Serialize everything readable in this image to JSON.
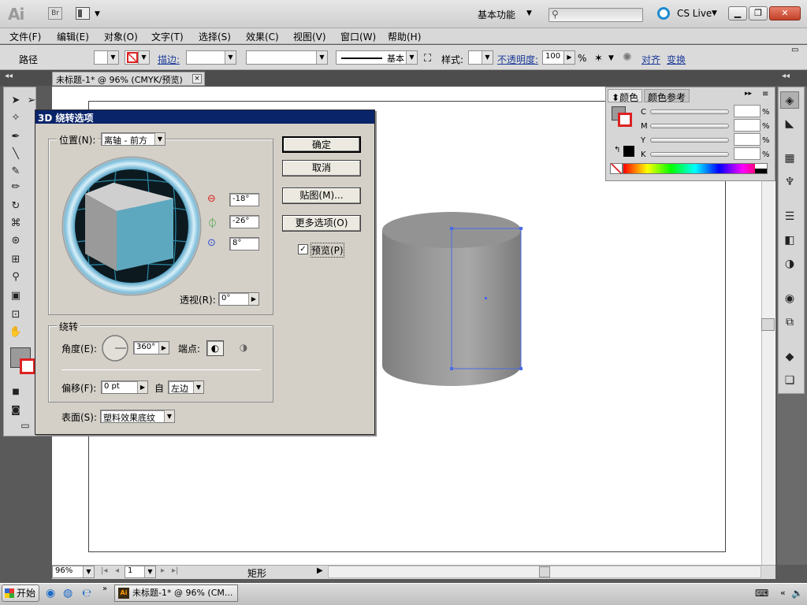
{
  "appbar": {
    "logo": "Ai",
    "bridge": "Br",
    "workspace": "基本功能",
    "cslive": "CS Live"
  },
  "menus": [
    "文件(F)",
    "编辑(E)",
    "对象(O)",
    "文字(T)",
    "选择(S)",
    "效果(C)",
    "视图(V)",
    "窗口(W)",
    "帮助(H)"
  ],
  "control": {
    "object_type": "路径",
    "stroke_label": "描边:",
    "stroke_profile": "基本",
    "style_label": "样式:",
    "opacity_label": "不透明度:",
    "opacity_value": "100",
    "opacity_unit": "%",
    "align_label": "对齐",
    "transform_label": "变换"
  },
  "document_tab": {
    "title": "未标题-1* @ 96% (CMYK/预览)",
    "close": "×"
  },
  "dialog": {
    "title": "3D 绕转选项",
    "position_label": "位置(N):",
    "position_value": "离轴 - 前方",
    "x_rotation": "-18°",
    "y_rotation": "-26°",
    "z_rotation": "8°",
    "perspective_label": "透视(R):",
    "perspective_value": "0°",
    "revolve_group": "绕转",
    "angle_label": "角度(E):",
    "angle_value": "360°",
    "cap_label": "端点:",
    "offset_label": "偏移(F):",
    "offset_value": "0 pt",
    "from_label": "自",
    "from_value": "左边",
    "surface_label": "表面(S):",
    "surface_value": "塑料效果底纹",
    "ok_button": "确定",
    "cancel_button": "取消",
    "map_art_button": "贴图(M)...",
    "more_options_button": "更多选项(O)",
    "preview_label": "预览(P)",
    "preview_checked": "✓"
  },
  "color_panel": {
    "tab_color": "颜色",
    "tab_guide": "颜色参考",
    "rows": [
      "C",
      "M",
      "Y",
      "K"
    ],
    "pct": "%"
  },
  "status": {
    "zoom": "96%",
    "page": "1",
    "tool": "矩形"
  },
  "taskbar": {
    "start": "开始",
    "task": "未标题-1* @ 96% (CM..."
  }
}
